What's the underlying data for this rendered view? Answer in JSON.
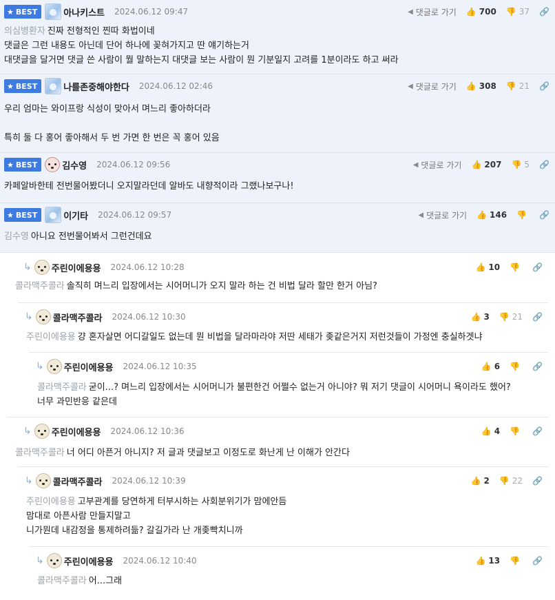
{
  "labels": {
    "best": "BEST",
    "goto": "댓글로 가기"
  },
  "comments": [
    {
      "nick": "아나키스트",
      "date": "2024.06.12 09:47",
      "up": "700",
      "down": "37",
      "mention": "의심병환자",
      "lines": [
        "진짜 전형적인 찐따 화법이네",
        "댓글은 그런 내용도 아닌데 단어 하나에 꽂혀가지고 딴 얘기하는거",
        "대댓글을 달거면 댓글 쓴 사람이 뭘 말하는지 대댓글 보는 사람이 뭔 기분일지 고려를 1분이라도 하고 써라"
      ]
    },
    {
      "nick": "나를존중해야한다",
      "date": "2024.06.12 02:46",
      "up": "308",
      "down": "21",
      "lines": [
        "우리 엄마는 와이프랑 식성이 맞아서 며느리 좋아하더라",
        "",
        "특히 둘 다 홍어 좋아해서 두 번 가면 한 번은 꼭 홍어 있음"
      ]
    },
    {
      "nick": "김수영",
      "date": "2024.06.12 09:56",
      "up": "207",
      "down": "5",
      "lines": [
        "카페알바한테 전번물어봤더니 오지말라던데 알바도 내향적이라 그랬나보구나!"
      ]
    },
    {
      "nick": "이기타",
      "date": "2024.06.12 09:57",
      "up": "146",
      "down": "",
      "mention": "김수영",
      "lines": [
        "아니요 전번물어봐서 그런건데요"
      ]
    },
    {
      "nick": "주린이에용용",
      "date": "2024.06.12 10:28",
      "up": "10",
      "down": "",
      "mention": "콜라맥주콜라",
      "lines": [
        "솔직히 며느리 입장에서는 시어머니가 오지 말라 하는 건 비법 달라 할만 한거 아님?"
      ]
    },
    {
      "nick": "콜라맥주콜라",
      "date": "2024.06.12 10:30",
      "up": "3",
      "down": "21",
      "mention": "주린이에용용",
      "lines": [
        "걍 혼자살면 어디갈일도 없는데 뭔 비법을 달라마라야 저딴 세태가 좆같은거지 저런것들이 가정엔 충실하겟냐"
      ]
    },
    {
      "nick": "주린이에용용",
      "date": "2024.06.12 10:35",
      "up": "6",
      "down": "",
      "mention": "콜라맥주콜라",
      "lines": [
        "굳이...? 며느리 입장에서는 시어머니가 불편한건 어쩔수 없는거 아니야? 뭐 저기 댓글이 시어머니 욕이라도 했어?",
        "너무 과민반응 같은데"
      ]
    },
    {
      "nick": "주린이에용용",
      "date": "2024.06.12 10:36",
      "up": "4",
      "down": "",
      "mention": "콜라맥주콜라",
      "lines": [
        "너 어디 아픈거 아니지? 저 글과 댓글보고 이정도로 화난게 난 이해가 안간다"
      ]
    },
    {
      "nick": "콜라맥주콜라",
      "date": "2024.06.12 10:39",
      "up": "2",
      "down": "22",
      "mention": "주린이에용용",
      "lines": [
        "고부관계를 당연하게 터부시하는 사회분위기가 맘에안듬",
        "맘대로 아픈사람 만들지말고",
        "니가뭔데 내감정을 통제하려듦? 갈길가라 난 개좆빡치니까"
      ]
    },
    {
      "nick": "주린이에용용",
      "date": "2024.06.12 10:40",
      "up": "13",
      "down": "",
      "mention": "콜라맥주콜라",
      "lines": [
        "어...그래"
      ]
    }
  ]
}
